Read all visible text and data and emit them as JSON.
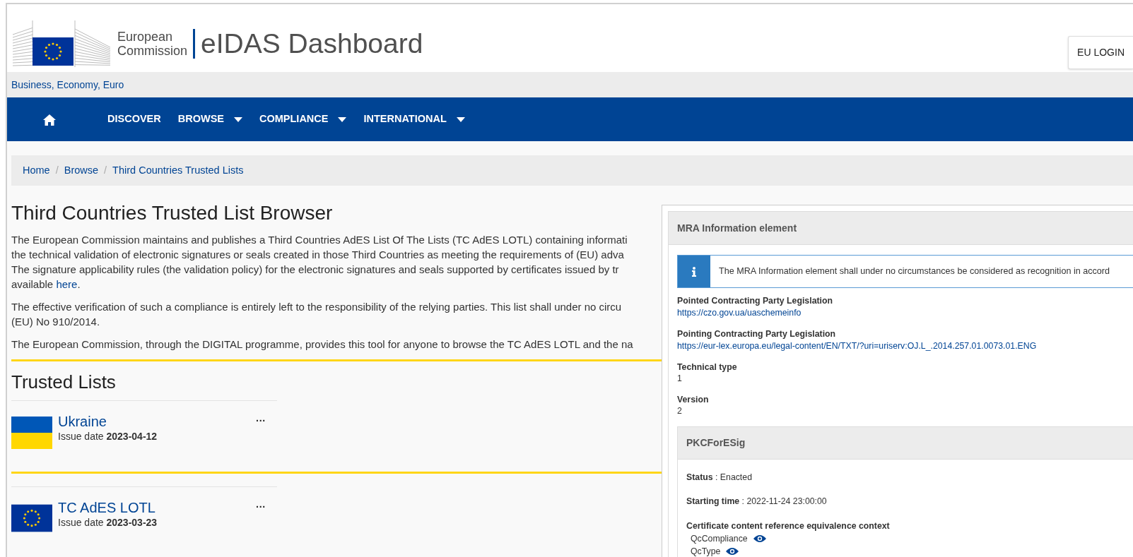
{
  "header": {
    "org_line1": "European",
    "org_line2": "Commission",
    "site_title": "eIDAS Dashboard",
    "login_button": "EU LOGIN"
  },
  "topic_bar": {
    "text": "Business, Economy, Euro"
  },
  "nav": {
    "items": [
      {
        "label": "DISCOVER",
        "dropdown": false
      },
      {
        "label": "BROWSE",
        "dropdown": true
      },
      {
        "label": "COMPLIANCE",
        "dropdown": true
      },
      {
        "label": "INTERNATIONAL",
        "dropdown": true
      }
    ]
  },
  "breadcrumb": {
    "separator": "/",
    "items": [
      "Home",
      "Browse",
      "Third Countries Trusted Lists"
    ]
  },
  "page_title": "Third Countries Trusted List Browser",
  "intro_paragraphs": [
    {
      "lines": [
        "The European Commission maintains and publishes a Third Countries AdES List Of The Lists (TC AdES LOTL) containing informati",
        "the technical validation of electronic signatures or seals created in those Third Countries as meeting the requirements of (EU) adva",
        "The signature applicability rules (the validation policy) for the electronic signatures and seals supported by certificates issued by tr"
      ],
      "link_prefix": "available ",
      "link": "here",
      "link_suffix": "."
    },
    {
      "lines": [
        "The effective verification of such a compliance is entirely left to the responsibility of the relying parties. This list shall under no circu",
        "(EU) No 910/2014."
      ]
    },
    {
      "lines": [
        "The European Commission, through the DIGITAL programme, provides this tool for anyone to browse the TC AdES LOTL and the na"
      ]
    }
  ],
  "trusted_lists": {
    "title": "Trusted Lists",
    "items": [
      {
        "name": "Ukraine",
        "kind": "bicolour",
        "issue_label": "Issue date",
        "issue_date": "2023-04-12",
        "menu": "···"
      },
      {
        "name": "TC AdES LOTL",
        "kind": "starred",
        "issue_label": "Issue date",
        "issue_date": "2023-03-23",
        "menu": "···"
      }
    ]
  },
  "mra_panel": {
    "title": "MRA Information element",
    "notice": "The MRA Information element shall under no circumstances be considered as recognition in accord",
    "fields": [
      {
        "label": "Pointed Contracting Party Legislation",
        "value": "https://czo.gov.ua/uaschemeinfo",
        "kind": "link"
      },
      {
        "label": "Pointing Contracting Party Legislation",
        "value": "https://eur-lex.europa.eu/legal-content/EN/TXT/?uri=uriserv:OJ.L_.2014.257.01.0073.01.ENG",
        "kind": "link"
      },
      {
        "label": "Technical type",
        "value": "1",
        "kind": "text"
      },
      {
        "label": "Version",
        "value": "2",
        "kind": "text"
      }
    ],
    "pkc": {
      "title": "PKCForESig",
      "separator": ":",
      "rows": [
        {
          "label": "Status",
          "value": "Enacted"
        },
        {
          "label": "Starting time",
          "value": "2022-11-24 23:00:00"
        }
      ],
      "context_title": "Certificate content reference equivalence context",
      "context_items": [
        "QcCompliance",
        "QcType"
      ]
    }
  }
}
